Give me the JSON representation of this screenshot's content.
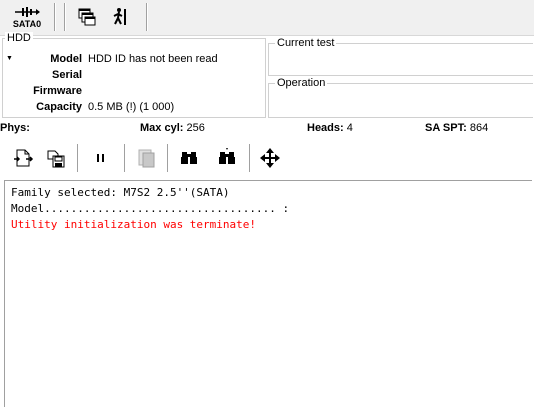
{
  "toolbar": {
    "sata_label": "SATA0"
  },
  "icons": {
    "sata": "sata-port-icon",
    "windows": "windows-icon",
    "run": "running-man-icon"
  },
  "hdd": {
    "title": "HDD",
    "rows": [
      {
        "label": "Model",
        "value": "HDD ID has not been read"
      },
      {
        "label": "Serial",
        "value": ""
      },
      {
        "label": "Firmware",
        "value": ""
      },
      {
        "label": "Capacity",
        "value": "0.5 MB (!) (1 000)"
      }
    ]
  },
  "current_test": {
    "title": "Current test"
  },
  "operation": {
    "title": "Operation"
  },
  "status": {
    "phys_label": "Phys:",
    "max_cyl_label": "Max cyl:",
    "max_cyl_value": "256",
    "heads_label": "Heads:",
    "heads_value": "4",
    "sa_spt_label": "SA SPT:",
    "sa_spt_value": "864"
  },
  "log": {
    "lines": [
      {
        "text": "Family selected: M7S2 2.5''(SATA)",
        "color": "#000000"
      },
      {
        "text": "Model................................... :",
        "color": "#000000"
      },
      {
        "text": "Utility initialization was terminate!",
        "color": "#ff0000"
      }
    ]
  }
}
